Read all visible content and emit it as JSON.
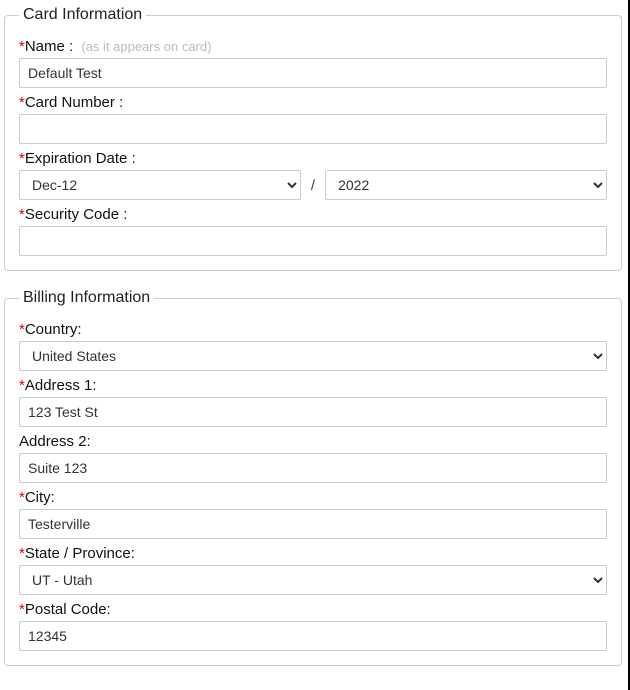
{
  "card": {
    "legend": "Card Information",
    "name_label": "Name :",
    "name_hint": "(as it appears on card)",
    "name_value": "Default Test",
    "number_label": "Card Number :",
    "number_value": "",
    "exp_label": "Expiration Date :",
    "exp_month_value": "Dec-12",
    "exp_year_value": "2022",
    "exp_sep": "/",
    "sec_label": "Security Code :",
    "sec_value": ""
  },
  "billing": {
    "legend": "Billing Information",
    "country_label": "Country:",
    "country_value": "United States",
    "addr1_label": "Address 1:",
    "addr1_value": "123 Test St",
    "addr2_label": "Address 2:",
    "addr2_value": "Suite 123",
    "city_label": "City:",
    "city_value": "Testerville",
    "state_label": "State / Province:",
    "state_value": "UT - Utah",
    "postal_label": "Postal Code:",
    "postal_value": "12345"
  },
  "asterisk": "*"
}
